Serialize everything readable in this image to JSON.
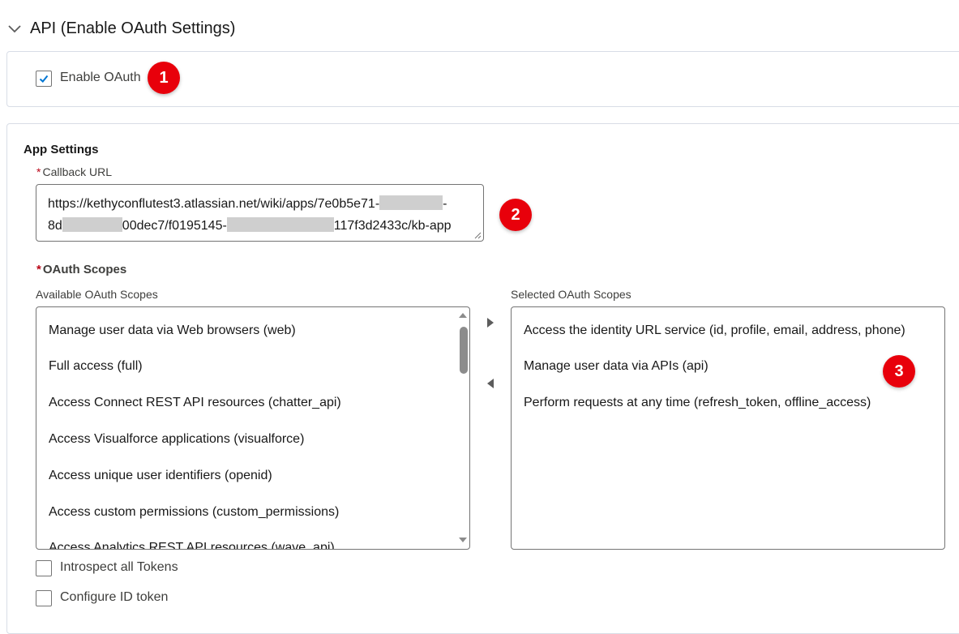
{
  "section": {
    "title": "API (Enable OAuth Settings)"
  },
  "enable_oauth": {
    "label": "Enable OAuth",
    "checked": true,
    "marker": "1"
  },
  "app_settings": {
    "heading": "App Settings",
    "required_mark": "*",
    "callback_url": {
      "label": "Callback URL",
      "line1_a": "https://kethyconflutest3.atlassian.net/wiki/apps/7e0b5e71-",
      "line1_b": "-",
      "line2_a": "8d",
      "line2_b": "00dec7/f0195145-",
      "line2_c": "117f3d2433c/kb-app"
    },
    "callback_marker": "2"
  },
  "oauth_scopes": {
    "label": "OAuth Scopes",
    "available_label": "Available OAuth Scopes",
    "selected_label": "Selected OAuth Scopes",
    "available": [
      "Manage user data via Web browsers (web)",
      "Full access (full)",
      "Access Connect REST API resources (chatter_api)",
      "Access Visualforce applications (visualforce)",
      "Access unique user identifiers (openid)",
      "Access custom permissions (custom_permissions)",
      "Access Analytics REST API resources (wave_api)"
    ],
    "selected": [
      "Access the identity URL service (id, profile, email, address, phone)",
      "Manage user data via APIs (api)",
      "Perform requests at any time (refresh_token, offline_access)"
    ],
    "selected_marker": "3"
  },
  "options": {
    "introspect_label": "Introspect all Tokens",
    "configure_id_label": "Configure ID token"
  },
  "colors": {
    "marker": "#e8000b",
    "checkbox_tick": "#0176d3",
    "required": "#ba0517"
  }
}
